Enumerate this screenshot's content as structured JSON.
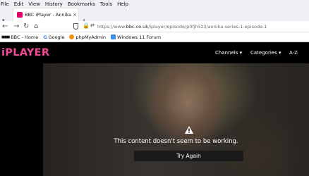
{
  "menubar": [
    "File",
    "Edit",
    "View",
    "History",
    "Bookmarks",
    "Tools",
    "Help"
  ],
  "tab": {
    "title": "BBC iPlayer - Annika - Serie",
    "close": "×",
    "new": "+"
  },
  "address": {
    "prefix": "https://www.",
    "domain": "bbc.co.uk",
    "path": "/iplayer/episode/p0fjh5z3/annika-series-1-episode-1"
  },
  "bookmarks": [
    {
      "label": "BBC - Home",
      "color": "#222222"
    },
    {
      "label": "Google",
      "color": "#ffffff"
    },
    {
      "label": "phpMyAdmin",
      "color": "#f29111"
    },
    {
      "label": "Windows 11 Forum",
      "color": "#3a8ee6"
    }
  ],
  "iplayer": {
    "logo": "iPLAYER",
    "brand_color": "#f54997",
    "nav": {
      "channels": "Channels ▾",
      "categories": "Categories ▾",
      "az": "A-Z"
    }
  },
  "player": {
    "error": "This content doesn't seem to be working.",
    "retry": "Try Again"
  }
}
